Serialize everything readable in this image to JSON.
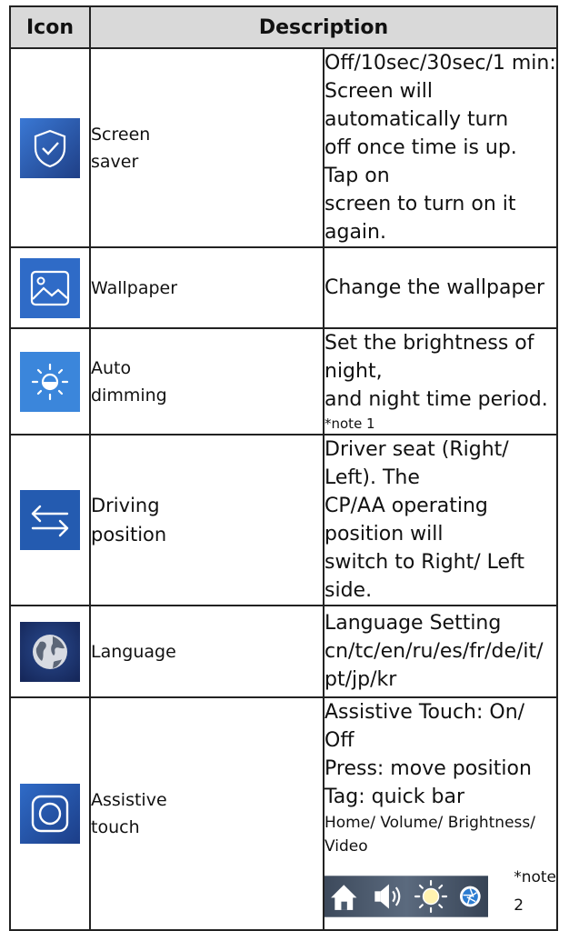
{
  "table": {
    "headers": {
      "icon": "Icon",
      "description": "Description"
    },
    "rows": [
      {
        "icon": "shield-check-icon",
        "name_lines": [
          "Screen",
          "saver"
        ],
        "desc_lines": [
          "Off/10sec/30sec/1 min:",
          "Screen will automatically turn",
          "off once time is up. Tap on",
          "screen to turn on it again."
        ]
      },
      {
        "icon": "picture-icon",
        "name_lines": [
          "Wallpaper"
        ],
        "desc_lines": [
          "Change the wallpaper"
        ]
      },
      {
        "icon": "brightness-icon",
        "name_lines": [
          "Auto",
          "dimming"
        ],
        "desc_lines": [
          "Set the brightness of night,",
          "and night time period."
        ],
        "note": "*note 1"
      },
      {
        "icon": "swap-arrows-icon",
        "name_lines": [
          "Driving",
          "position"
        ],
        "desc_lines": [
          "Driver seat (Right/ Left). The",
          "CP/AA operating position will",
          "switch to Right/ Left side."
        ]
      },
      {
        "icon": "globe-icon",
        "name_lines": [
          "Language"
        ],
        "desc_lines": [
          "Language Setting",
          "cn/tc/en/ru/es/fr/de/it/",
          "pt/jp/kr"
        ]
      },
      {
        "icon": "assistive-touch-icon",
        "name_lines": [
          "Assistive",
          "touch"
        ],
        "desc_lines": [
          "Assistive Touch: On/ Off",
          "Press: move position",
          "Tag: quick bar"
        ],
        "sub_line": "Home/ Volume/ Brightness/ Video",
        "strip_icons": [
          "home-icon",
          "volume-icon",
          "brightness-icon",
          "video-shutter-icon"
        ],
        "note": "*note 2"
      }
    ]
  },
  "colors": {
    "tile_dark": "#1f3f86",
    "tile_light": "#3a78d4",
    "header_bg": "#d9d9d9"
  }
}
